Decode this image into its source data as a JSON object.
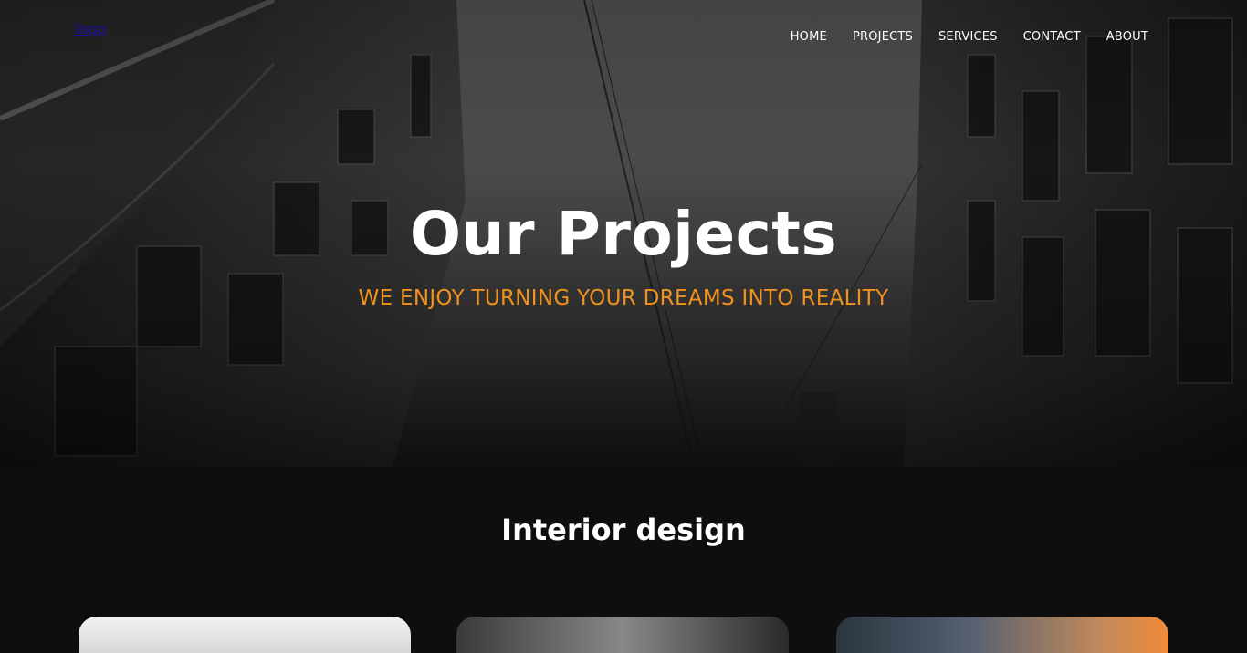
{
  "header": {
    "logo": "logo",
    "nav": [
      "HOME",
      "PROJECTS",
      "SERVICES",
      "CONTACT",
      "ABOUT"
    ]
  },
  "hero": {
    "title": "Our Projects",
    "subtitle": "WE ENJOY TURNING YOUR DREAMS INTO REALITY",
    "background_image": "building-perspective-image"
  },
  "section": {
    "title": "Interior design",
    "cards": [
      "project-image-1",
      "project-image-2",
      "project-image-3"
    ]
  },
  "colors": {
    "accent": "#f0921f",
    "background": "#0e0e0e",
    "text": "#ffffff",
    "logo_link": "#1a0dab"
  }
}
